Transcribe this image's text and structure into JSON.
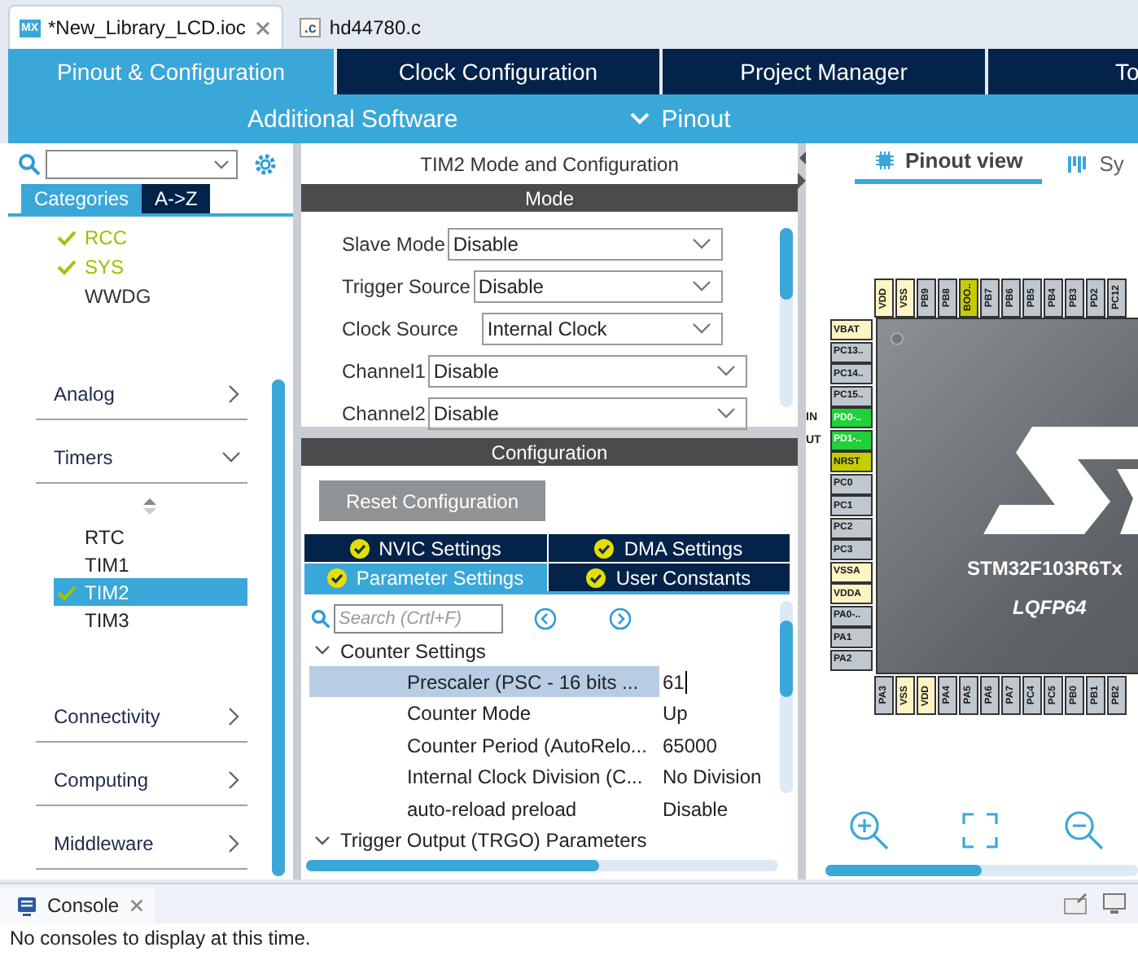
{
  "editor_tabs": [
    {
      "label": "*New_Library_LCD.ioc",
      "badge": "MX",
      "kind": "mx",
      "selected": true,
      "closable": true
    },
    {
      "label": "hd44780.c",
      "badge": ".c",
      "kind": "source",
      "selected": false,
      "closable": false
    }
  ],
  "main_tabs": [
    {
      "label": "Pinout & Configuration",
      "selected": true
    },
    {
      "label": "Clock Configuration",
      "selected": false
    },
    {
      "label": "Project Manager",
      "selected": false
    },
    {
      "label": "To",
      "selected": false
    }
  ],
  "sub_tabs": {
    "additional": "Additional Software",
    "pinout": "Pinout"
  },
  "left_panel": {
    "tabs": [
      {
        "label": "Categories",
        "selected": true
      },
      {
        "label": "A->Z",
        "selected": false
      }
    ],
    "system_items": [
      {
        "label": "RCC",
        "checked": true
      },
      {
        "label": "SYS",
        "checked": true
      },
      {
        "label": "WWDG",
        "checked": false
      }
    ],
    "categories": [
      {
        "label": "Analog",
        "expanded": false
      },
      {
        "label": "Timers",
        "expanded": true,
        "children": [
          {
            "label": "RTC",
            "checked": false,
            "selected": false
          },
          {
            "label": "TIM1",
            "checked": false,
            "selected": false
          },
          {
            "label": "TIM2",
            "checked": true,
            "selected": true
          },
          {
            "label": "TIM3",
            "checked": false,
            "selected": false
          }
        ]
      },
      {
        "label": "Connectivity",
        "expanded": false
      },
      {
        "label": "Computing",
        "expanded": false
      },
      {
        "label": "Middleware",
        "expanded": false
      }
    ]
  },
  "middle_panel": {
    "title": "TIM2 Mode and Configuration",
    "mode_header": "Mode",
    "mode_fields": [
      {
        "label": "Slave Mode",
        "value": "Disable"
      },
      {
        "label": "Trigger Source",
        "value": "Disable"
      },
      {
        "label": "Clock Source",
        "value": "Internal Clock"
      },
      {
        "label": "Channel1",
        "value": "Disable"
      },
      {
        "label": "Channel2",
        "value": "Disable"
      }
    ],
    "config_header": "Configuration",
    "reset_button": "Reset Configuration",
    "settings_tabs": [
      {
        "label": "NVIC Settings",
        "selected": false
      },
      {
        "label": "DMA Settings",
        "selected": false
      },
      {
        "label": "Parameter Settings",
        "selected": true
      },
      {
        "label": "User Constants",
        "selected": false
      }
    ],
    "search": {
      "placeholder": "Search (Crtl+F)"
    },
    "tree": [
      {
        "label": "Counter Settings",
        "expanded": true,
        "children": [
          {
            "name": "Prescaler (PSC - 16 bits ...",
            "value": "61",
            "selected": true
          },
          {
            "name": "Counter Mode",
            "value": "Up",
            "selected": false
          },
          {
            "name": "Counter Period (AutoRelo...",
            "value": "65000",
            "selected": false
          },
          {
            "name": "Internal Clock Division (C...",
            "value": "No Division",
            "selected": false
          },
          {
            "name": "auto-reload preload",
            "value": "Disable",
            "selected": false
          }
        ]
      },
      {
        "label": "Trigger Output (TRGO) Parameters",
        "expanded": true
      }
    ]
  },
  "right_panel": {
    "tabs": [
      {
        "label": "Pinout view",
        "selected": true
      },
      {
        "label": "Sy",
        "selected": false
      }
    ],
    "chip": {
      "name": "STM32F103R6Tx",
      "package": "LQFP64",
      "pins_top": [
        {
          "label": "VDD",
          "kind": "power"
        },
        {
          "label": "VSS",
          "kind": "power"
        },
        {
          "label": "PB9",
          "kind": "io"
        },
        {
          "label": "PB8",
          "kind": "io"
        },
        {
          "label": "BOO..",
          "kind": "reserved"
        },
        {
          "label": "PB7",
          "kind": "io"
        },
        {
          "label": "PB6",
          "kind": "io"
        },
        {
          "label": "PB5",
          "kind": "io"
        },
        {
          "label": "PB4",
          "kind": "io"
        },
        {
          "label": "PB3",
          "kind": "io"
        },
        {
          "label": "PD2",
          "kind": "io"
        },
        {
          "label": "PC12",
          "kind": "io"
        }
      ],
      "pins_left": [
        {
          "label": "VBAT",
          "kind": "power"
        },
        {
          "label": "PC13..",
          "kind": "io"
        },
        {
          "label": "PC14..",
          "kind": "io"
        },
        {
          "label": "PC15..",
          "kind": "io"
        },
        {
          "label": "PD0-..",
          "kind": "assigned",
          "signal": "IN"
        },
        {
          "label": "PD1-..",
          "kind": "assigned",
          "signal": "UT"
        },
        {
          "label": "NRST",
          "kind": "reserved"
        },
        {
          "label": "PC0",
          "kind": "io"
        },
        {
          "label": "PC1",
          "kind": "io"
        },
        {
          "label": "PC2",
          "kind": "io"
        },
        {
          "label": "PC3",
          "kind": "io"
        },
        {
          "label": "VSSA",
          "kind": "power"
        },
        {
          "label": "VDDA",
          "kind": "power"
        },
        {
          "label": "PA0-..",
          "kind": "io"
        },
        {
          "label": "PA1",
          "kind": "io"
        },
        {
          "label": "PA2",
          "kind": "io"
        }
      ],
      "pins_bottom": [
        {
          "label": "PA3",
          "kind": "io"
        },
        {
          "label": "VSS",
          "kind": "power"
        },
        {
          "label": "VDD",
          "kind": "power"
        },
        {
          "label": "PA4",
          "kind": "io"
        },
        {
          "label": "PA5",
          "kind": "io"
        },
        {
          "label": "PA6",
          "kind": "io"
        },
        {
          "label": "PA7",
          "kind": "io"
        },
        {
          "label": "PC4",
          "kind": "io"
        },
        {
          "label": "PC5",
          "kind": "io"
        },
        {
          "label": "PB0",
          "kind": "io"
        },
        {
          "label": "PB1",
          "kind": "io"
        },
        {
          "label": "PB2",
          "kind": "io"
        }
      ]
    }
  },
  "console": {
    "title": "Console",
    "message": "No consoles to display at this time."
  }
}
